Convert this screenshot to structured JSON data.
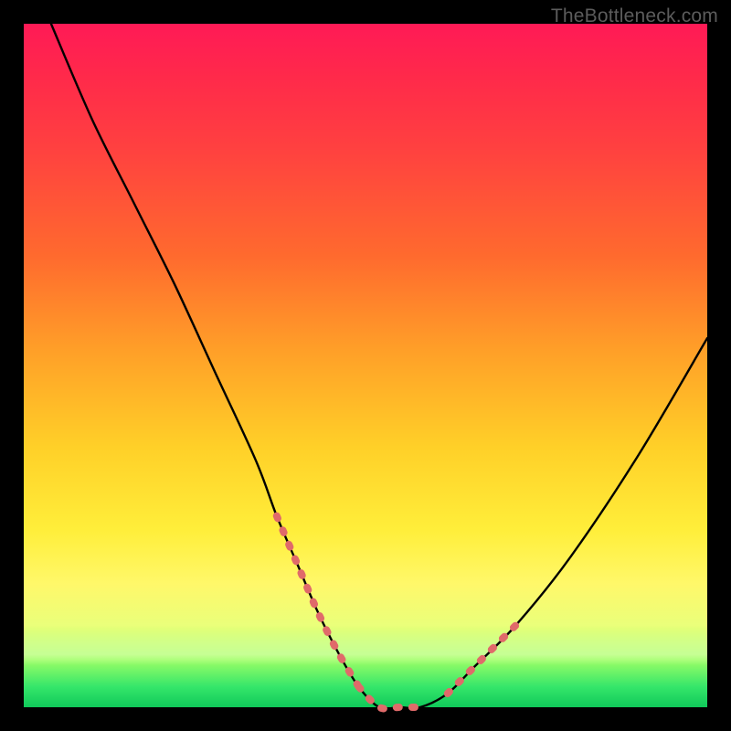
{
  "watermark": "TheBottleneck.com",
  "chart_data": {
    "type": "line",
    "title": "",
    "xlabel": "",
    "ylabel": "",
    "xlim": [
      0,
      100
    ],
    "ylim": [
      0,
      100
    ],
    "grid": false,
    "series": [
      {
        "name": "bottleneck-curve",
        "x": [
          4,
          10,
          16,
          22,
          28,
          34,
          37,
          40,
          43,
          46,
          49,
          52,
          55,
          58,
          62,
          66,
          72,
          80,
          90,
          100
        ],
        "y": [
          100,
          86,
          74,
          62,
          49,
          36,
          28,
          21,
          14,
          8,
          3,
          0,
          0,
          0,
          2,
          6,
          12,
          22,
          37,
          54
        ]
      }
    ],
    "highlight_segments": [
      {
        "name": "left-arm-dotted",
        "x": [
          37,
          40,
          43,
          46,
          49
        ],
        "y": [
          28,
          21,
          14,
          8,
          3
        ]
      },
      {
        "name": "trough-dotted",
        "x": [
          49,
          52,
          55,
          58
        ],
        "y": [
          3,
          0,
          0,
          0
        ]
      },
      {
        "name": "right-arm-dotted",
        "x": [
          62,
          66,
          72
        ],
        "y": [
          2,
          6,
          12
        ]
      }
    ],
    "colors": {
      "curve": "#000000",
      "highlight": "#e06a6a",
      "gradient_top": "#ff1a56",
      "gradient_bottom": "#10c95a"
    }
  }
}
